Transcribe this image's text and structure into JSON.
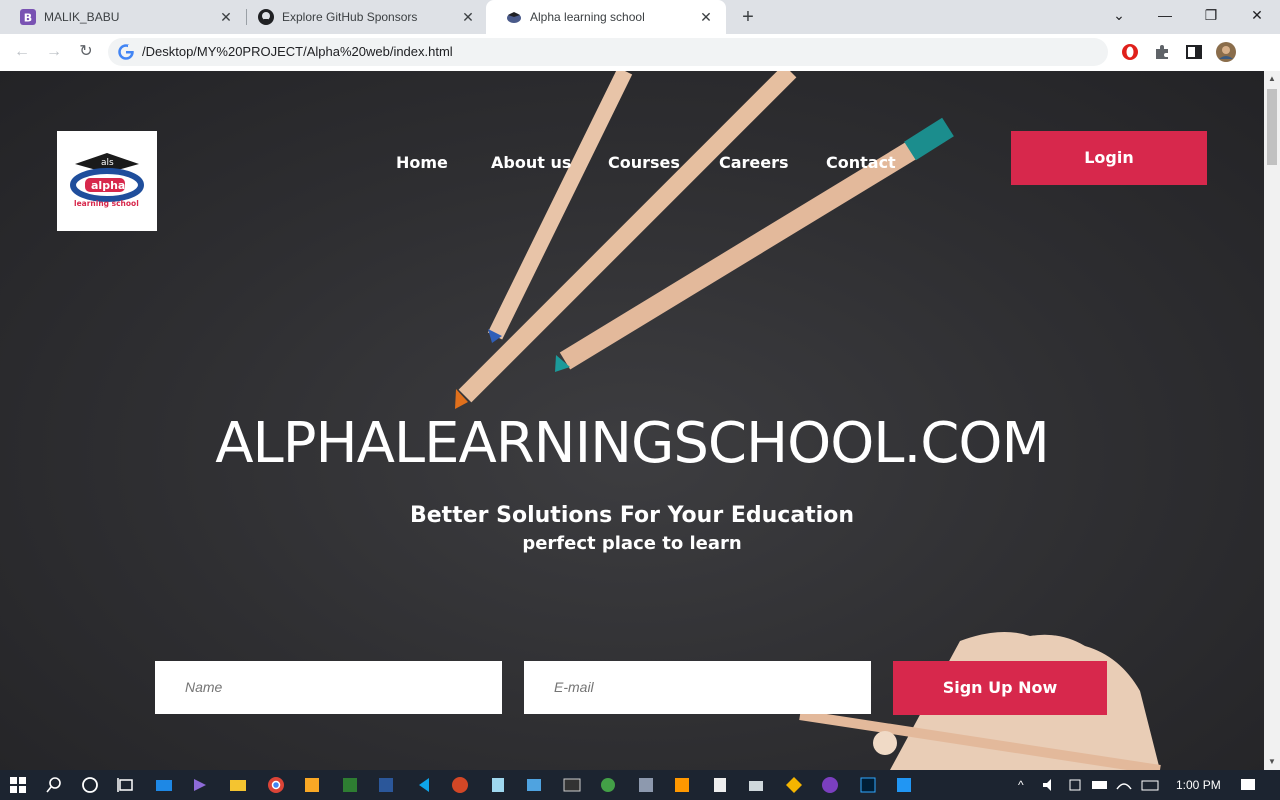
{
  "browser": {
    "tabs": [
      {
        "title": "MALIK_BABU",
        "icon": "bootstrap-icon"
      },
      {
        "title": "Explore GitHub Sponsors",
        "icon": "github-icon"
      },
      {
        "title": "Alpha learning school",
        "icon": "page-favicon"
      }
    ],
    "url": "/Desktop/MY%20PROJECT/Alpha%20web/index.html"
  },
  "site": {
    "logo": {
      "line1": "als",
      "line2": "alpha",
      "line3": "learning school"
    },
    "nav": [
      "Home",
      "About us",
      "Courses",
      "Careers",
      "Contact"
    ],
    "login_label": "Login",
    "hero_title": "ALPHALEARNINGSCHOOL.COM",
    "hero_subtitle": "Better Solutions For Your Education",
    "hero_tagline": "perfect place to learn",
    "form": {
      "name_placeholder": "Name",
      "email_placeholder": "E-mail",
      "submit_label": "Sign Up Now"
    }
  },
  "colors": {
    "accent": "#d7284c",
    "tab_strip": "#dee1e6",
    "taskbar": "#1c2430"
  },
  "taskbar": {
    "time": "1:00 PM"
  }
}
